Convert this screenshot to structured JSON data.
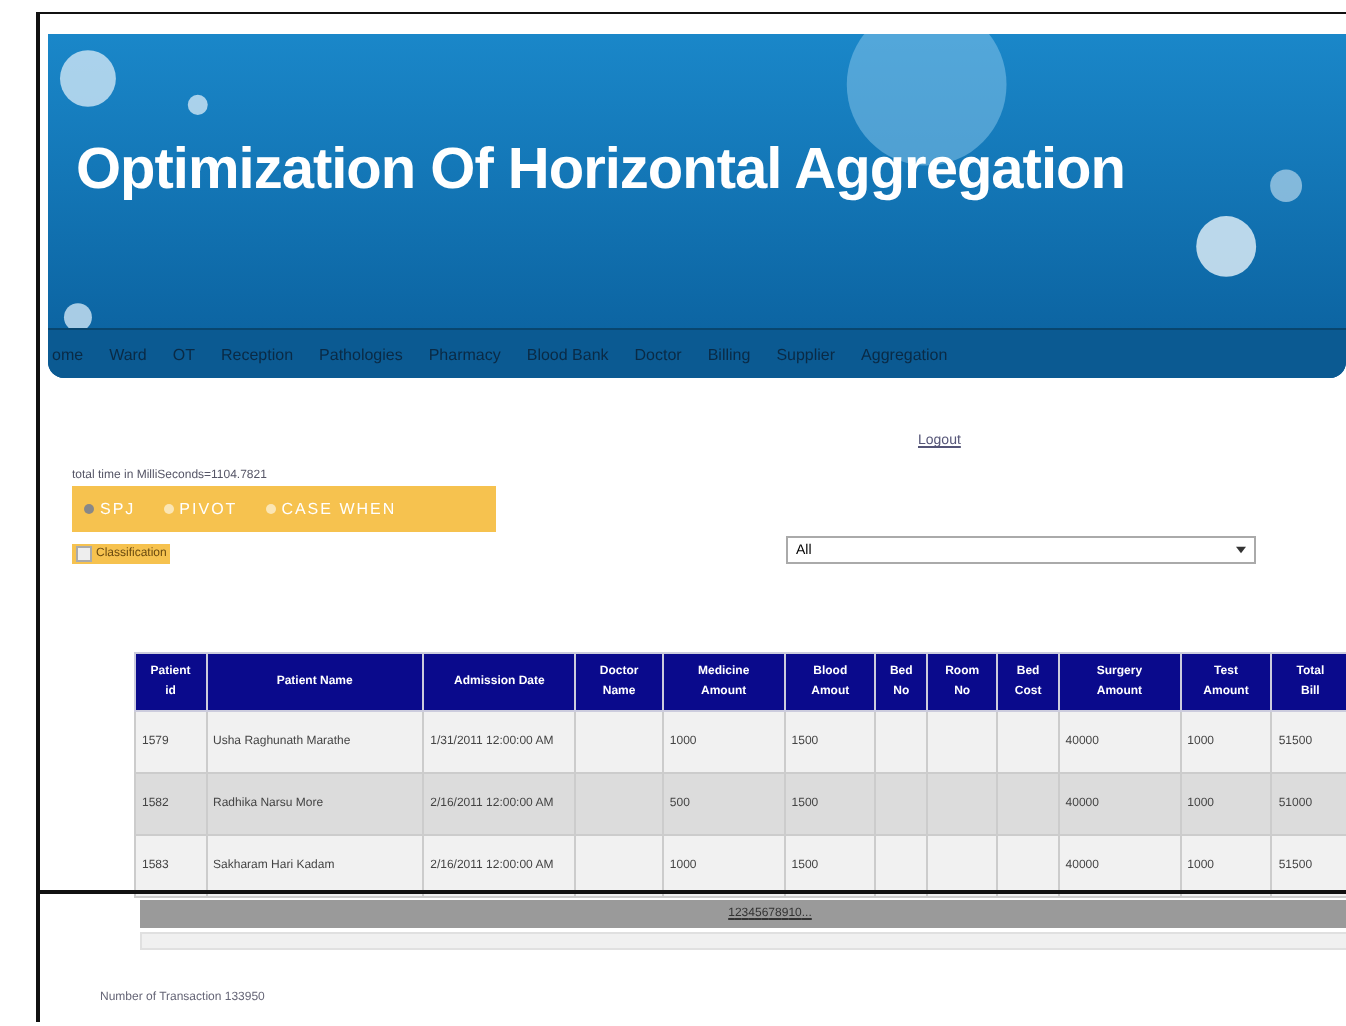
{
  "header": {
    "title": "Optimization Of Horizontal Aggregation"
  },
  "nav": [
    "ome",
    "Ward",
    "OT",
    "Reception",
    "Pathologies",
    "Pharmacy",
    "Blood Bank",
    "Doctor",
    "Billing",
    "Supplier",
    "Aggregation"
  ],
  "logout": "Logout",
  "timing": "total time in MilliSeconds=1104.7821",
  "methods": [
    {
      "label": "SPJ",
      "selected": true
    },
    {
      "label": "PIVOT",
      "selected": false
    },
    {
      "label": "CASE WHEN",
      "selected": false
    }
  ],
  "classification": {
    "label": "Classification",
    "checked": false
  },
  "filter": {
    "value": "All"
  },
  "table": {
    "columns": [
      "Patient\nid",
      "Patient Name",
      "Admission Date",
      "Doctor\nName",
      "Medicine\nAmount",
      "Blood\nAmout",
      "Bed\nNo",
      "Room\nNo",
      "Bed\nCost",
      "Surgery\nAmount",
      "Test\nAmount",
      "Total\nBill"
    ],
    "rows": [
      [
        "1579",
        "Usha Raghunath Marathe",
        "1/31/2011 12:00:00 AM",
        "",
        "1000",
        "1500",
        "",
        "",
        "",
        "40000",
        "1000",
        "51500"
      ],
      [
        "1582",
        "Radhika Narsu More",
        "2/16/2011 12:00:00 AM",
        "",
        "500",
        "1500",
        "",
        "",
        "",
        "40000",
        "1000",
        "51000"
      ],
      [
        "1583",
        "Sakharam Hari Kadam",
        "2/16/2011 12:00:00 AM",
        "",
        "1000",
        "1500",
        "",
        "",
        "",
        "40000",
        "1000",
        "51500"
      ]
    ]
  },
  "pager": [
    "1",
    "2",
    "3",
    "4",
    "5",
    "6",
    "7",
    "8",
    "9",
    "10",
    "..."
  ],
  "footer": "Number of Transaction 133950"
}
